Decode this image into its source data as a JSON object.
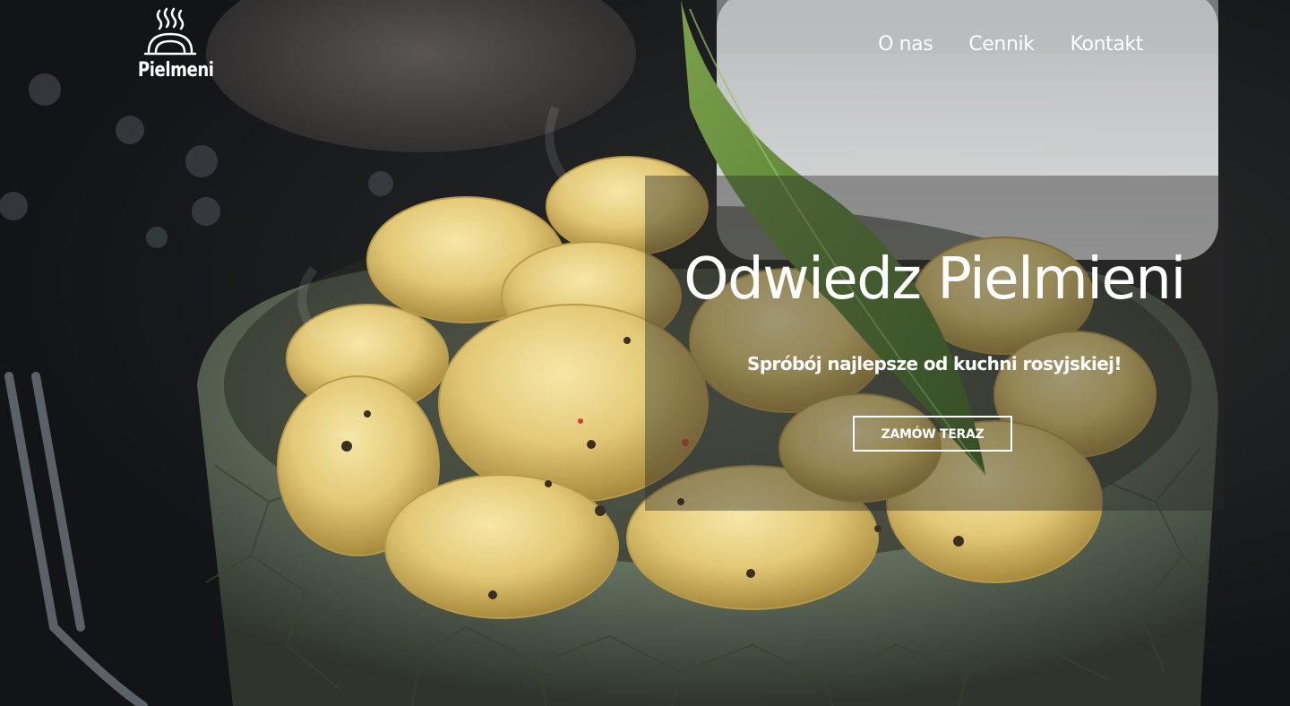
{
  "brand": {
    "name": "Pielmeni",
    "icon": "steaming-cloche-icon"
  },
  "nav": {
    "items": [
      {
        "label": "O nas"
      },
      {
        "label": "Cennik"
      },
      {
        "label": "Kontakt"
      }
    ]
  },
  "hero": {
    "title": "Odwiedz Pielmieni",
    "subtitle": "Spróbój najlepsze od kuchni rosyjskiej!",
    "cta_label": "ZAMÓW TERAZ",
    "background": "pelmeni-bowl-photo"
  },
  "colors": {
    "text": "#ffffff",
    "overlay": "rgba(40,40,38,0.42)",
    "background": "#15171c"
  }
}
